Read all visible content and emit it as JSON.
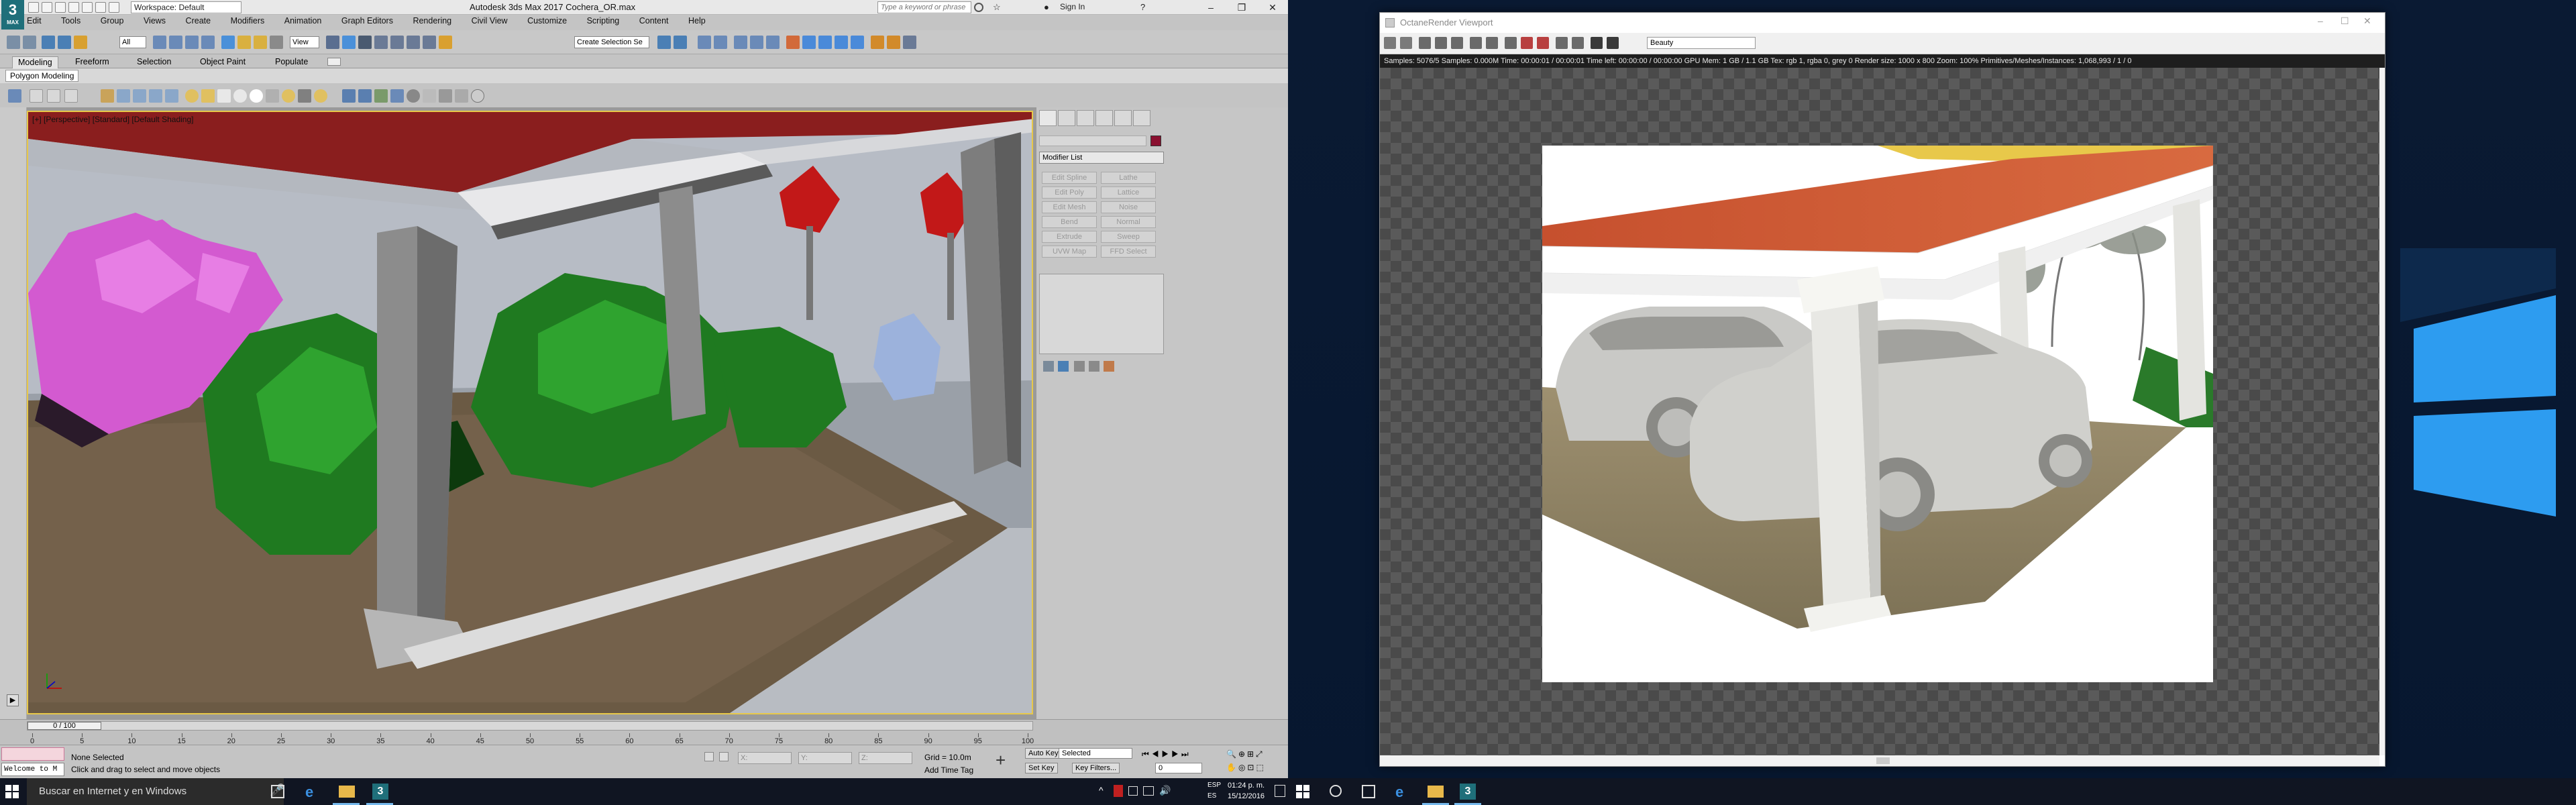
{
  "max": {
    "logo_big": "3",
    "logo_small": "MAX",
    "workspace": "Workspace: Default",
    "title": "Autodesk 3ds Max 2017     Cochera_OR.max",
    "search_placeholder": "Type a keyword or phrase",
    "sign_in": "Sign In",
    "menu": [
      "Edit",
      "Tools",
      "Group",
      "Views",
      "Create",
      "Modifiers",
      "Animation",
      "Graph Editors",
      "Rendering",
      "Civil View",
      "Customize",
      "Scripting",
      "Content",
      "Help"
    ],
    "toolbar_all": "All",
    "toolbar_view": "View",
    "toolbar_selset": "Create Selection Se",
    "ribbon_tabs": [
      "Modeling",
      "Freeform",
      "Selection",
      "Object Paint",
      "Populate"
    ],
    "ribbon_sub": "Polygon Modeling",
    "viewport_label": "[+] [Perspective] [Standard] [Default Shading]",
    "modifier_list": "Modifier List",
    "modifier_buttons": [
      "Edit Spline",
      "Lathe",
      "Edit Poly",
      "Lattice",
      "Edit Mesh",
      "Noise",
      "Bend",
      "Normal",
      "Extrude",
      "Sweep",
      "UVW Map",
      "FFD Select"
    ],
    "time_slider": "0 / 100",
    "ruler_ticks": [
      "0",
      "5",
      "10",
      "15",
      "20",
      "25",
      "30",
      "35",
      "40",
      "45",
      "50",
      "55",
      "60",
      "65",
      "70",
      "75",
      "80",
      "85",
      "90",
      "95",
      "100"
    ],
    "status_selected": "None Selected",
    "status_hint": "Click and drag to select and move objects",
    "welcome": "Welcome to M",
    "coord_x": "X:",
    "coord_y": "Y:",
    "coord_z": "Z:",
    "grid": "Grid = 10.0m",
    "add_time_tag": "Add Time Tag",
    "auto_key": "Auto Key",
    "set_key": "Set Key",
    "selected": "Selected",
    "key_filters": "Key Filters...",
    "frame": "0"
  },
  "render": {
    "title": "OctaneRender Viewport",
    "pass": "Beauty",
    "stats": "Samples: 5076/5   Samples: 0.000M   Time: 00:00:01 / 00:00:01   Time left: 00:00:00 / 00:00:00   GPU Mem: 1 GB / 1.1 GB   Tex: rgb 1, rgba 0, grey 0   Render size: 1000 x 800   Zoom: 100%   Primitives/Meshes/Instances: 1,068,993 / 1 / 0"
  },
  "taskbar": {
    "search": "Buscar en Internet y en Windows",
    "time": "01:24 p. m.",
    "date": "15/12/2016",
    "lang1": "ESP",
    "lang2": "ES"
  },
  "colors": {
    "accent_viewport": "#e7c84a",
    "win_blue": "#2d9cf0",
    "max_brand": "#1f6f7a"
  }
}
